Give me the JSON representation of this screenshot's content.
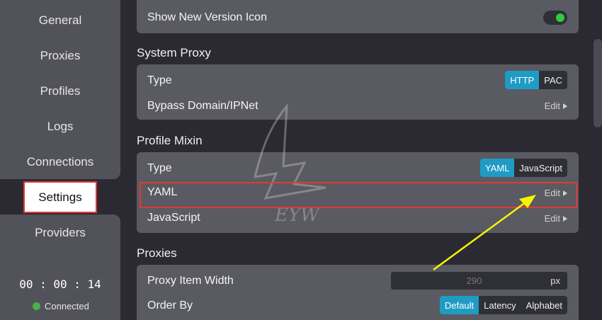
{
  "sidebar": {
    "items": [
      {
        "label": "General"
      },
      {
        "label": "Proxies"
      },
      {
        "label": "Profiles"
      },
      {
        "label": "Logs"
      },
      {
        "label": "Connections"
      },
      {
        "label": "Settings"
      },
      {
        "label": "Providers"
      }
    ],
    "timer": "00 : 00 : 14",
    "status": "Connected"
  },
  "general": {
    "show_new_version_icon": "Show New Version Icon"
  },
  "system_proxy": {
    "title": "System Proxy",
    "type_label": "Type",
    "type_options": [
      "HTTP",
      "PAC"
    ],
    "bypass_label": "Bypass Domain/IPNet",
    "edit_label": "Edit"
  },
  "profile_mixin": {
    "title": "Profile Mixin",
    "type_label": "Type",
    "type_options": [
      "YAML",
      "JavaScript"
    ],
    "yaml_label": "YAML",
    "javascript_label": "JavaScript",
    "edit_label": "Edit"
  },
  "proxies": {
    "title": "Proxies",
    "item_width_label": "Proxy Item Width",
    "item_width_value": "290",
    "item_width_unit": "px",
    "order_by_label": "Order By",
    "order_options": [
      "Default",
      "Latency",
      "Alphabet"
    ]
  },
  "watermark": "EYW",
  "colors": {
    "accent": "#1f9bc4",
    "highlight": "#e53935",
    "arrow": "#f5f500",
    "connected": "#4caf50"
  }
}
